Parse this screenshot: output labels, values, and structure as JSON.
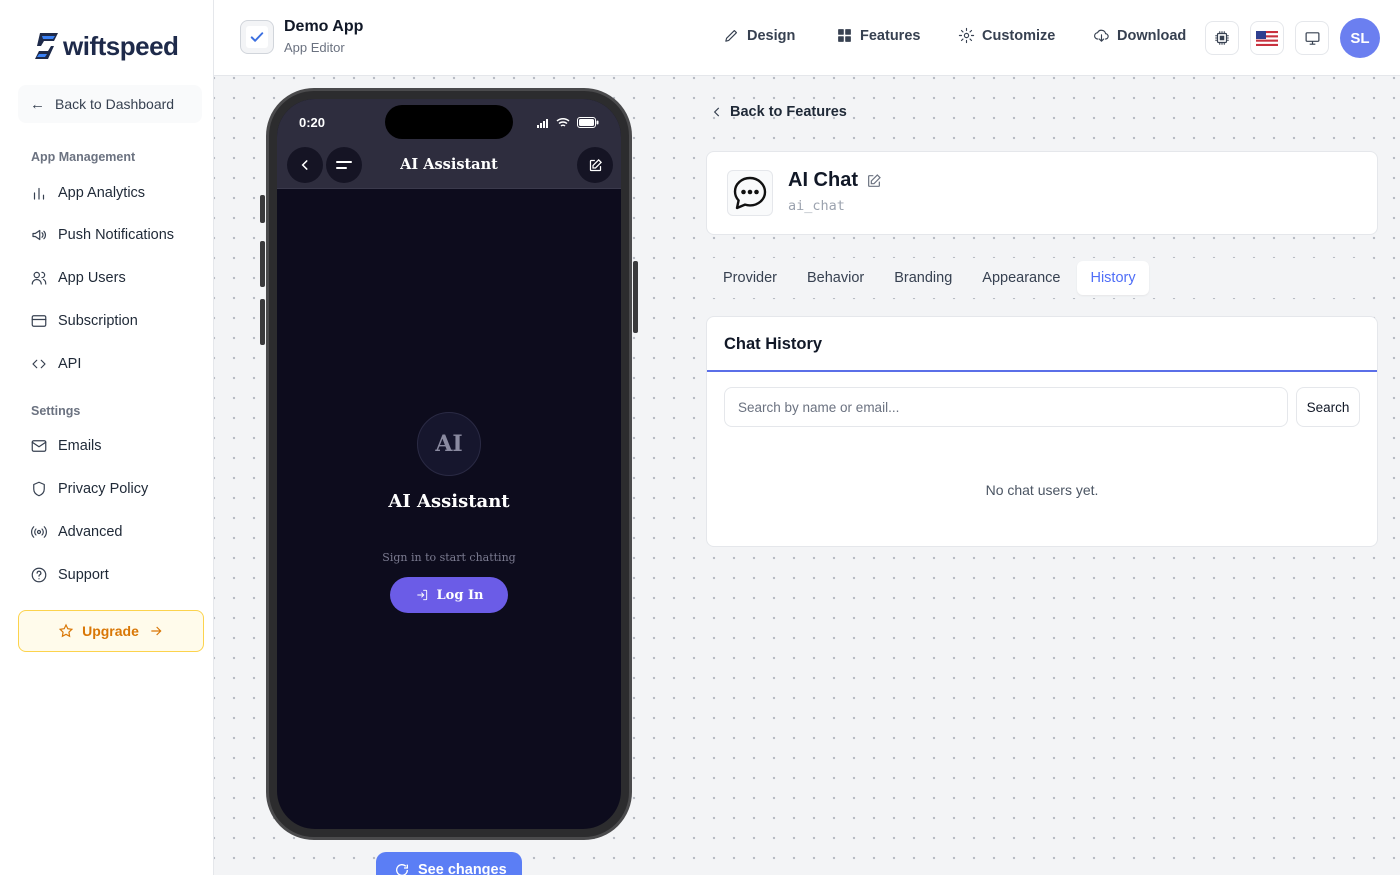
{
  "brand": {
    "logo_text": "wiftspeed"
  },
  "sidebar": {
    "back_label": "Back to Dashboard",
    "section_app": "App Management",
    "items_app": [
      "App Analytics",
      "Push Notifications",
      "App Users",
      "Subscription",
      "API"
    ],
    "section_settings": "Settings",
    "items_settings": [
      "Emails",
      "Privacy Policy",
      "Advanced",
      "Support"
    ],
    "upgrade_label": "Upgrade"
  },
  "header": {
    "app_name": "Demo App",
    "app_subtitle": "App Editor",
    "nav": [
      "Design",
      "Features",
      "Customize",
      "Download"
    ],
    "avatar_initials": "SL"
  },
  "phone": {
    "time": "0:20",
    "title": "AI Assistant",
    "avatar_text": "AI",
    "heading": "AI Assistant",
    "subtitle": "Sign in to start chatting",
    "login_label": "Log In"
  },
  "see_changes_label": "See changes",
  "feature": {
    "back_label": "Back to Features",
    "name": "AI Chat",
    "id": "ai_chat"
  },
  "tabs": [
    {
      "label": "Provider",
      "active": false
    },
    {
      "label": "Behavior",
      "active": false
    },
    {
      "label": "Branding",
      "active": false
    },
    {
      "label": "Appearance",
      "active": false
    },
    {
      "label": "History",
      "active": true
    }
  ],
  "history": {
    "title": "Chat History",
    "search_placeholder": "Search by name or email...",
    "search_value": "",
    "search_button": "Search",
    "empty_text": "No chat users yet."
  },
  "colors": {
    "accent": "#5b7ef5",
    "avatar": "#6b7ff0",
    "upgrade": "#d97706",
    "phone_bg": "#0d0c1d",
    "login_button": "#6b5ce7"
  },
  "icons": {
    "sidebar_app": [
      "bar-chart-icon",
      "megaphone-icon",
      "users-icon",
      "credit-card-icon",
      "code-icon"
    ],
    "sidebar_settings": [
      "mail-icon",
      "shield-icon",
      "broadcast-icon",
      "help-circle-icon"
    ],
    "header_nav": [
      "pen-icon",
      "grid-icon",
      "gear-icon",
      "cloud-download-icon"
    ]
  }
}
